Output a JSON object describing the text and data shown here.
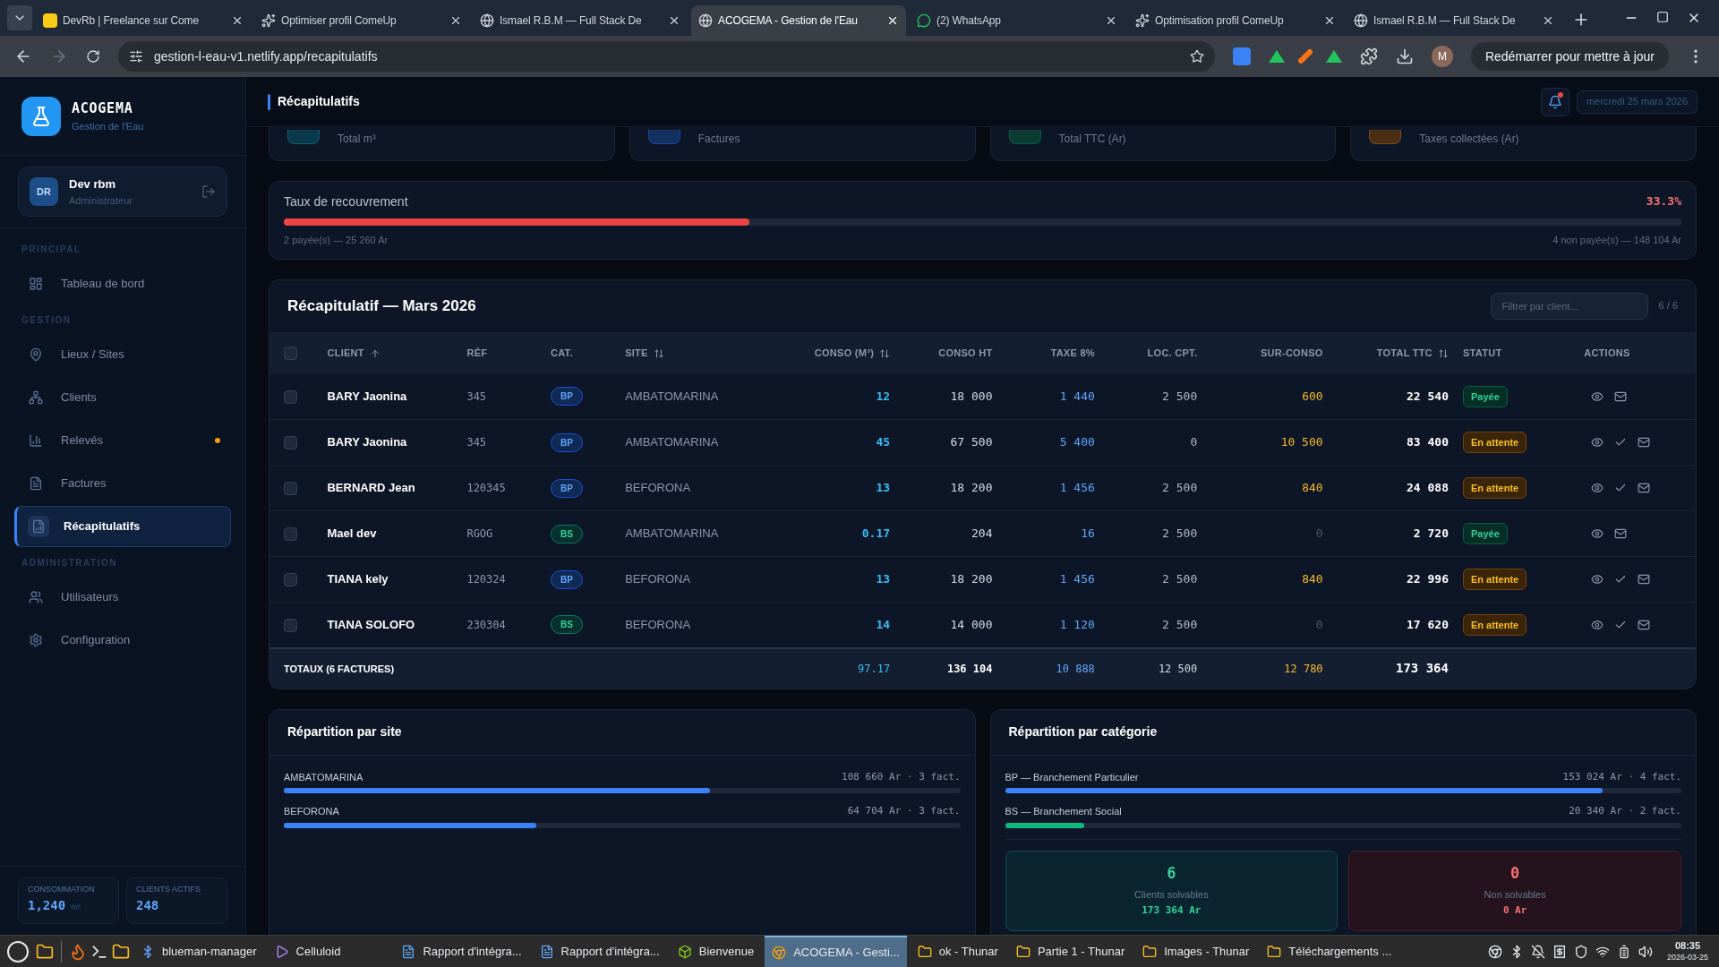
{
  "browser": {
    "tabs": [
      {
        "title": "DevRb | Freelance sur Come",
        "kind": "square",
        "selected": false
      },
      {
        "title": "Optimiser profil ComeUp",
        "kind": "sparkle",
        "selected": false
      },
      {
        "title": "Ismael R.B.M — Full Stack De",
        "kind": "globe",
        "selected": false
      },
      {
        "title": "ACOGEMA - Gestion de l'Eau",
        "kind": "globe",
        "selected": true
      },
      {
        "title": "(2) WhatsApp",
        "kind": "chat",
        "selected": false
      },
      {
        "title": "Optimisation profil ComeUp",
        "kind": "sparkle",
        "selected": false
      },
      {
        "title": "Ismael R.B.M — Full Stack De",
        "kind": "globe",
        "selected": false
      }
    ],
    "url": "gestion-l-eau-v1.netlify.app/recapitulatifs",
    "update_button": "Redémarrer pour mettre à jour",
    "profile_initial": "M"
  },
  "sidebar": {
    "brand": {
      "name": "ACOGEMA",
      "subtitle": "Gestion de l'Eau"
    },
    "user": {
      "initials": "DR",
      "name": "Dev rbm",
      "role": "Administrateur"
    },
    "sections": [
      {
        "title": "PRINCIPAL",
        "items": [
          {
            "label": "Tableau de bord",
            "kind": "dashboard",
            "selected": false,
            "dot": false
          }
        ]
      },
      {
        "title": "GESTION",
        "items": [
          {
            "label": "Lieux / Sites",
            "kind": "pin",
            "selected": false,
            "dot": false
          },
          {
            "label": "Clients",
            "kind": "clients",
            "selected": false,
            "dot": false
          },
          {
            "label": "Relevés",
            "kind": "chart",
            "selected": false,
            "dot": true
          },
          {
            "label": "Factures",
            "kind": "file",
            "selected": false,
            "dot": false
          },
          {
            "label": "Récapitulatifs",
            "kind": "report",
            "selected": true,
            "dot": false
          }
        ]
      },
      {
        "title": "ADMINISTRATION",
        "items": [
          {
            "label": "Utilisateurs",
            "kind": "users",
            "selected": false,
            "dot": false
          },
          {
            "label": "Configuration",
            "kind": "gear",
            "selected": false,
            "dot": false
          }
        ]
      }
    ],
    "stats": [
      {
        "label": "CONSOMMATION",
        "value": "1,240",
        "unit": "m³"
      },
      {
        "label": "CLIENTS ACTIFS",
        "value": "248"
      }
    ]
  },
  "header": {
    "title": "Récapitulatifs",
    "notification": true,
    "date": "mercredi 25 mars 2026"
  },
  "stat_cards": [
    {
      "label": "Total m³",
      "kind": "cyan"
    },
    {
      "label": "Factures",
      "kind": "blue"
    },
    {
      "label": "Total TTC (Ar)",
      "kind": "green"
    },
    {
      "label": "Taxes collectées (Ar)",
      "kind": "orange"
    }
  ],
  "recovery": {
    "title": "Taux de recouvrement",
    "percent": "33.3%",
    "level": 0.333,
    "paid": "2 payée(s) — 25 260 Ar",
    "unpaid": "4 non payée(s) — 148 104 Ar"
  },
  "table": {
    "title": "Récapitulatif — Mars 2026",
    "filter_placeholder": "Filtrer par client...",
    "count": "6 / 6",
    "select_all": false,
    "columns": [
      {
        "label": "CLIENT",
        "kind": "ascending"
      },
      {
        "label": "RÉF",
        "kind": "plain"
      },
      {
        "label": "CAT.",
        "kind": "plain"
      },
      {
        "label": "SITE",
        "kind": "sortable"
      },
      {
        "label": "CONSO (M³)",
        "kind": "sortable"
      },
      {
        "label": "CONSO HT",
        "kind": "plain"
      },
      {
        "label": "TAXE 8%",
        "kind": "plain"
      },
      {
        "label": "LOC. CPT.",
        "kind": "plain"
      },
      {
        "label": "SUR-CONSO",
        "kind": "plain"
      },
      {
        "label": "TOTAL TTC",
        "kind": "sortable"
      },
      {
        "label": "STATUT",
        "kind": "plain"
      },
      {
        "label": "ACTIONS",
        "kind": "plain"
      }
    ],
    "rows": [
      {
        "checked": false,
        "client": "BARY Jaonina",
        "ref": "345",
        "cat": {
          "label": "BP",
          "kind": "particulier"
        },
        "site": "AMBATOMARINA",
        "conso": "12",
        "conso_ht": "18 000",
        "taxe": "1 440",
        "loc": "2 500",
        "surconso": "600",
        "surconso_zero": false,
        "total": "22 540",
        "status": {
          "label": "Payée",
          "kind": "paid"
        },
        "can_validate": false
      },
      {
        "checked": false,
        "client": "BARY Jaonina",
        "ref": "345",
        "cat": {
          "label": "BP",
          "kind": "particulier"
        },
        "site": "AMBATOMARINA",
        "conso": "45",
        "conso_ht": "67 500",
        "taxe": "5 400",
        "loc": "0",
        "surconso": "10 500",
        "surconso_zero": false,
        "total": "83 400",
        "status": {
          "label": "En attente",
          "kind": "pending"
        },
        "can_validate": true
      },
      {
        "checked": false,
        "client": "BERNARD Jean",
        "ref": "120345",
        "cat": {
          "label": "BP",
          "kind": "particulier"
        },
        "site": "BEFORONA",
        "conso": "13",
        "conso_ht": "18 200",
        "taxe": "1 456",
        "loc": "2 500",
        "surconso": "840",
        "surconso_zero": false,
        "total": "24 088",
        "status": {
          "label": "En attente",
          "kind": "pending"
        },
        "can_validate": true
      },
      {
        "checked": false,
        "client": "Mael dev",
        "ref": "RGOG",
        "cat": {
          "label": "BS",
          "kind": "social"
        },
        "site": "AMBATOMARINA",
        "conso": "0.17",
        "conso_ht": "204",
        "taxe": "16",
        "loc": "2 500",
        "surconso": "0",
        "surconso_zero": true,
        "total": "2 720",
        "status": {
          "label": "Payée",
          "kind": "paid"
        },
        "can_validate": false
      },
      {
        "checked": false,
        "client": "TIANA kely",
        "ref": "120324",
        "cat": {
          "label": "BP",
          "kind": "particulier"
        },
        "site": "BEFORONA",
        "conso": "13",
        "conso_ht": "18 200",
        "taxe": "1 456",
        "loc": "2 500",
        "surconso": "840",
        "surconso_zero": false,
        "total": "22 996",
        "status": {
          "label": "En attente",
          "kind": "pending"
        },
        "can_validate": true
      },
      {
        "checked": false,
        "client": "TIANA SOLOFO",
        "ref": "230304",
        "cat": {
          "label": "BS",
          "kind": "social"
        },
        "site": "BEFORONA",
        "conso": "14",
        "conso_ht": "14 000",
        "taxe": "1 120",
        "loc": "2 500",
        "surconso": "0",
        "surconso_zero": true,
        "total": "17 620",
        "status": {
          "label": "En attente",
          "kind": "pending"
        },
        "can_validate": true
      }
    ],
    "totals": {
      "label": "TOTAUX (6 FACTURES)",
      "conso": "97.17",
      "conso_ht": "136 104",
      "taxe": "10 888",
      "loc": "12 500",
      "surconso": "12 780",
      "total": "173 364"
    }
  },
  "by_site": {
    "title": "Répartition par site",
    "items": [
      {
        "label": "AMBATOMARINA",
        "value": "108 660 Ar · 3 fact.",
        "level": 0.63,
        "color": "#3b82f6"
      },
      {
        "label": "BEFORONA",
        "value": "64 704 Ar · 3 fact.",
        "level": 0.373,
        "color": "#3b82f6"
      }
    ]
  },
  "by_category": {
    "title": "Répartition par catégorie",
    "items": [
      {
        "label": "BP — Branchement Particulier",
        "value": "153 024 Ar · 4 fact.",
        "level": 0.883,
        "color": "#3b82f6"
      },
      {
        "label": "BS — Branchement Social",
        "value": "20 340 Ar · 2 fact.",
        "level": 0.117,
        "color": "#10b981"
      }
    ],
    "boxes": [
      {
        "count": "6",
        "label": "Clients solvables",
        "amount": "173 364 Ar",
        "kind": "good"
      },
      {
        "count": "0",
        "label": "Non solvables",
        "amount": "0 Ar",
        "kind": "bad"
      }
    ]
  },
  "taskbar": {
    "items": [
      {
        "label": "blueman-manager",
        "kind": "bluetooth",
        "selected": false
      },
      {
        "label": "Celluloid",
        "kind": "video",
        "selected": false
      },
      {
        "label": "Rapport d'intégra...",
        "kind": "doc",
        "selected": false
      },
      {
        "label": "Rapport d'intégra...",
        "kind": "doc",
        "selected": false
      },
      {
        "label": "Bienvenue",
        "kind": "app",
        "selected": false
      },
      {
        "label": "ACOGEMA - Gesti...",
        "kind": "chrome",
        "selected": true
      },
      {
        "label": "ok - Thunar",
        "kind": "folder",
        "selected": false
      },
      {
        "label": "Partie 1 - Thunar",
        "kind": "folder",
        "selected": false
      },
      {
        "label": "Images - Thunar",
        "kind": "folder",
        "selected": false
      },
      {
        "label": "Téléchargements ...",
        "kind": "folder",
        "selected": false
      }
    ],
    "time": "08:35",
    "date": "2026-03-25"
  }
}
